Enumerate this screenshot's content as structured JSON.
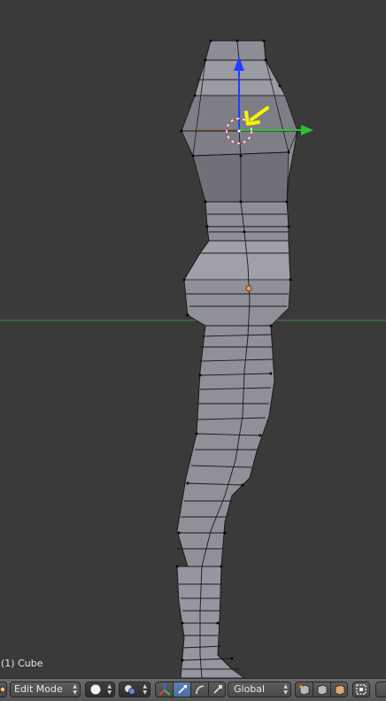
{
  "viewport": {
    "object_label": "(1) Cube"
  },
  "header": {
    "mode_label": "Edit Mode",
    "orientation_label": "Global",
    "icons": {
      "editor_type": "object-mode-icon",
      "shading": "solid-shading-icon",
      "pivot": "pivot-point-icon",
      "manipulator": "manipulator-axes-icon",
      "translate": "translate-icon",
      "rotate": "rotate-icon",
      "scale": "scale-icon",
      "layers": "layers-icon",
      "snap": "snap-icon"
    }
  },
  "colors": {
    "mesh_face": "#8f9098",
    "mesh_edge": "#1a1a1a",
    "y_axis": "#2fbf2f",
    "z_axis": "#1f3fff",
    "cursor": "#ffffff",
    "annotation_arrow": "#f5f500",
    "selected_button": "#5b7fb1"
  }
}
